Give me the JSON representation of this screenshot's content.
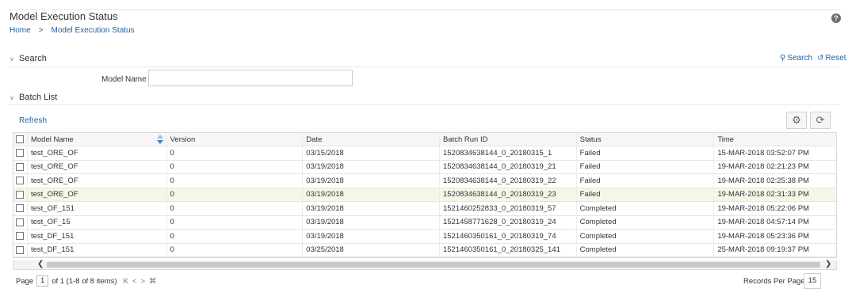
{
  "page": {
    "title": "Model Execution Status",
    "help_label": "?"
  },
  "breadcrumb": {
    "home": "Home",
    "separator": ">",
    "current": "Model Execution Status"
  },
  "search": {
    "section_label": "Search",
    "search_button": "Search",
    "reset_button": "Reset",
    "model_name_label": "Model Name",
    "model_name_value": ""
  },
  "batch_list": {
    "section_label": "Batch List",
    "refresh_label": "Refresh",
    "columns": [
      "Model Name",
      "Version",
      "Date",
      "Batch Run ID",
      "Status",
      "Time"
    ],
    "rows": [
      {
        "model_name": "test_ORE_OF",
        "version": "0",
        "date": "03/15/2018",
        "batch_run_id": "1520834638144_0_20180315_1",
        "status": "Failed",
        "time": "15-MAR-2018 03:52:07 PM"
      },
      {
        "model_name": "test_ORE_OF",
        "version": "0",
        "date": "03/19/2018",
        "batch_run_id": "1520834638144_0_20180319_21",
        "status": "Failed",
        "time": "19-MAR-2018 02:21:23 PM"
      },
      {
        "model_name": "test_ORE_OF",
        "version": "0",
        "date": "03/19/2018",
        "batch_run_id": "1520834638144_0_20180319_22",
        "status": "Failed",
        "time": "19-MAR-2018 02:25:38 PM"
      },
      {
        "model_name": "test_ORE_OF",
        "version": "0",
        "date": "03/19/2018",
        "batch_run_id": "1520834638144_0_20180319_23",
        "status": "Failed",
        "time": "19-MAR-2018 02:31:33 PM"
      },
      {
        "model_name": "test_OF_151",
        "version": "0",
        "date": "03/19/2018",
        "batch_run_id": "1521460252833_0_20180319_57",
        "status": "Completed",
        "time": "19-MAR-2018 05:22:06 PM"
      },
      {
        "model_name": "test_OF_15",
        "version": "0",
        "date": "03/19/2018",
        "batch_run_id": "1521458771628_0_20180319_24",
        "status": "Completed",
        "time": "19-MAR-2018 04:57:14 PM"
      },
      {
        "model_name": "test_DF_151",
        "version": "0",
        "date": "03/19/2018",
        "batch_run_id": "1521460350161_0_20180319_74",
        "status": "Completed",
        "time": "19-MAR-2018 05:23:36 PM"
      },
      {
        "model_name": "test_DF_151",
        "version": "0",
        "date": "03/25/2018",
        "batch_run_id": "1521460350161_0_20180325_141",
        "status": "Completed",
        "time": "25-MAR-2018 09:19:37 PM"
      }
    ],
    "selected_row_index": 3
  },
  "pager": {
    "page_label": "Page",
    "page_value": "1",
    "summary": "of 1 (1-8 of 8 items)",
    "records_per_page_label": "Records Per Page",
    "records_per_page_value": "15"
  }
}
